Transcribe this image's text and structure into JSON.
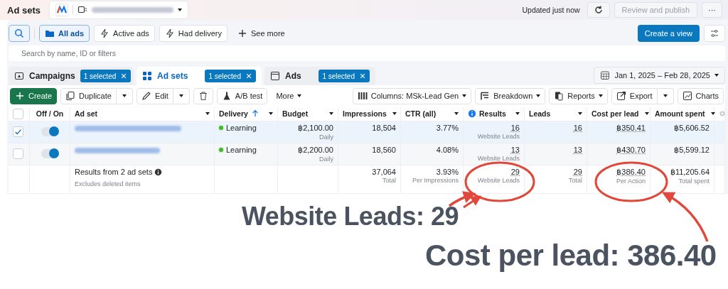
{
  "header": {
    "title": "Ad sets",
    "updated": "Updated just now",
    "review_button": "Review and publish",
    "more_button": "···"
  },
  "filters": [
    {
      "label": "All ads",
      "selected": true,
      "kind": "folder"
    },
    {
      "label": "Active ads",
      "selected": false,
      "kind": "bolt"
    },
    {
      "label": "Had delivery",
      "selected": false,
      "kind": "bolt"
    },
    {
      "label": "See more",
      "selected": false,
      "kind": "plus"
    }
  ],
  "create_view_button": "Create a view",
  "search": {
    "placeholder": "Search by name, ID or filters"
  },
  "level_tabs": [
    {
      "label": "Campaigns",
      "badge": "1 selected",
      "selected": false,
      "kind": "campaign"
    },
    {
      "label": "Ad sets",
      "badge": "1 selected",
      "selected": true,
      "kind": "adset"
    },
    {
      "label": "Ads",
      "badge": "1 selected",
      "selected": false,
      "kind": "ad"
    }
  ],
  "date_range": "Jan 1, 2025 – Feb 28, 2025",
  "toolbar_left": [
    {
      "label": "Create",
      "kind": "primary"
    },
    {
      "label": "Duplicate",
      "kind": "split-copy"
    },
    {
      "label": "Edit",
      "kind": "split-edit"
    },
    {
      "kind": "trash"
    },
    {
      "label": "A/B test",
      "kind": "flask"
    },
    {
      "label": "More",
      "kind": "menu"
    }
  ],
  "toolbar_right": [
    {
      "label": "Columns: MSk-Lead Gen",
      "kind": "columns"
    },
    {
      "label": "Breakdown",
      "kind": "breakdown"
    },
    {
      "label": "Reports",
      "kind": "reports"
    },
    {
      "label": "Export",
      "kind": "export"
    },
    {
      "label": "Charts",
      "kind": "charts"
    }
  ],
  "table": {
    "select_all": {
      "checked": false
    },
    "columns": [
      {
        "label": "Off / On",
        "kind": "plain"
      },
      {
        "label": "Ad set",
        "kind": "menu"
      },
      {
        "label": "Delivery",
        "kind": "sorted"
      },
      {
        "label": "Budget",
        "kind": "menu"
      },
      {
        "label": "Impressions",
        "kind": "menu"
      },
      {
        "label": "CTR (all)",
        "kind": "menu"
      },
      {
        "label": "Results",
        "kind": "info"
      },
      {
        "label": "Leads",
        "kind": "menu"
      },
      {
        "label": "Cost per lead",
        "kind": "menu"
      },
      {
        "label": "Amount spent",
        "kind": "menu"
      }
    ],
    "rows": [
      {
        "selected": true,
        "on": true,
        "delivery": "Learning",
        "budget": "฿2,100.00",
        "budget_note": "Daily",
        "impressions": "18,504",
        "ctr": "3.77%",
        "results": "16",
        "results_note": "Website Leads",
        "leads": "16",
        "cost": "฿350.41",
        "amount": "฿5,606.52"
      },
      {
        "selected": false,
        "on": true,
        "delivery": "Learning",
        "budget": "฿2,200.00",
        "budget_note": "Daily",
        "impressions": "18,560",
        "ctr": "4.08%",
        "results": "13",
        "results_note": "Website Leads",
        "leads": "13",
        "cost": "฿430.70",
        "amount": "฿5,599.12"
      }
    ],
    "totals": {
      "label": "Results from 2 ad sets",
      "note": "Excludes deleted items",
      "impressions": "37,064",
      "impressions_note": "Total",
      "ctr": "3.93%",
      "ctr_note": "Per Impressions",
      "results": "29",
      "results_note": "Website Leads",
      "leads": "29",
      "leads_note": "Total",
      "cost": "฿386.40",
      "cost_note": "Per Action",
      "amount": "฿11,205.64",
      "amount_note": "Total spent"
    }
  },
  "annotations": [
    "Website Leads: 29",
    "Cost per lead: 386.40"
  ]
}
